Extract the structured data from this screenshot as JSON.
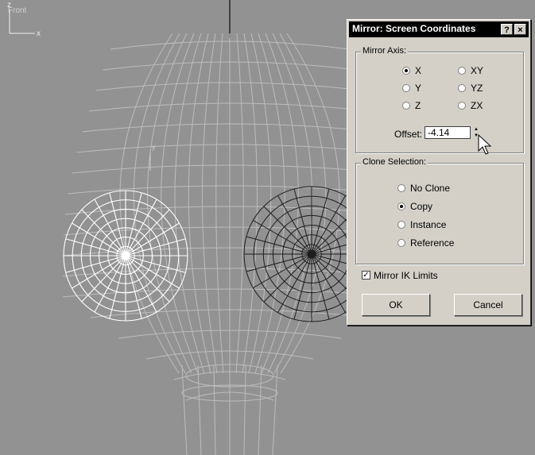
{
  "viewport": {
    "label": "Front",
    "axis_z": "z",
    "axis_x": "x",
    "axis_y": "y",
    "background": "#929292",
    "wire_color": "#bdbdbd",
    "eye_selected_color": "#ffffff",
    "eye_unselected_color": "#1e1e1e"
  },
  "dialog": {
    "title": "Mirror: Screen Coordinates",
    "help_label": "?",
    "close_label": "×",
    "mirror_axis": {
      "legend": "Mirror Axis:",
      "options": [
        "X",
        "Y",
        "Z",
        "XY",
        "YZ",
        "ZX"
      ],
      "selected": "X",
      "offset_label": "Offset:",
      "offset_value": "-4.14"
    },
    "clone_selection": {
      "legend": "Clone Selection:",
      "options": [
        "No Clone",
        "Copy",
        "Instance",
        "Reference"
      ],
      "selected": "Copy"
    },
    "mirror_ik": {
      "label": "Mirror IK Limits",
      "checked": true
    },
    "ok_label": "OK",
    "cancel_label": "Cancel"
  }
}
